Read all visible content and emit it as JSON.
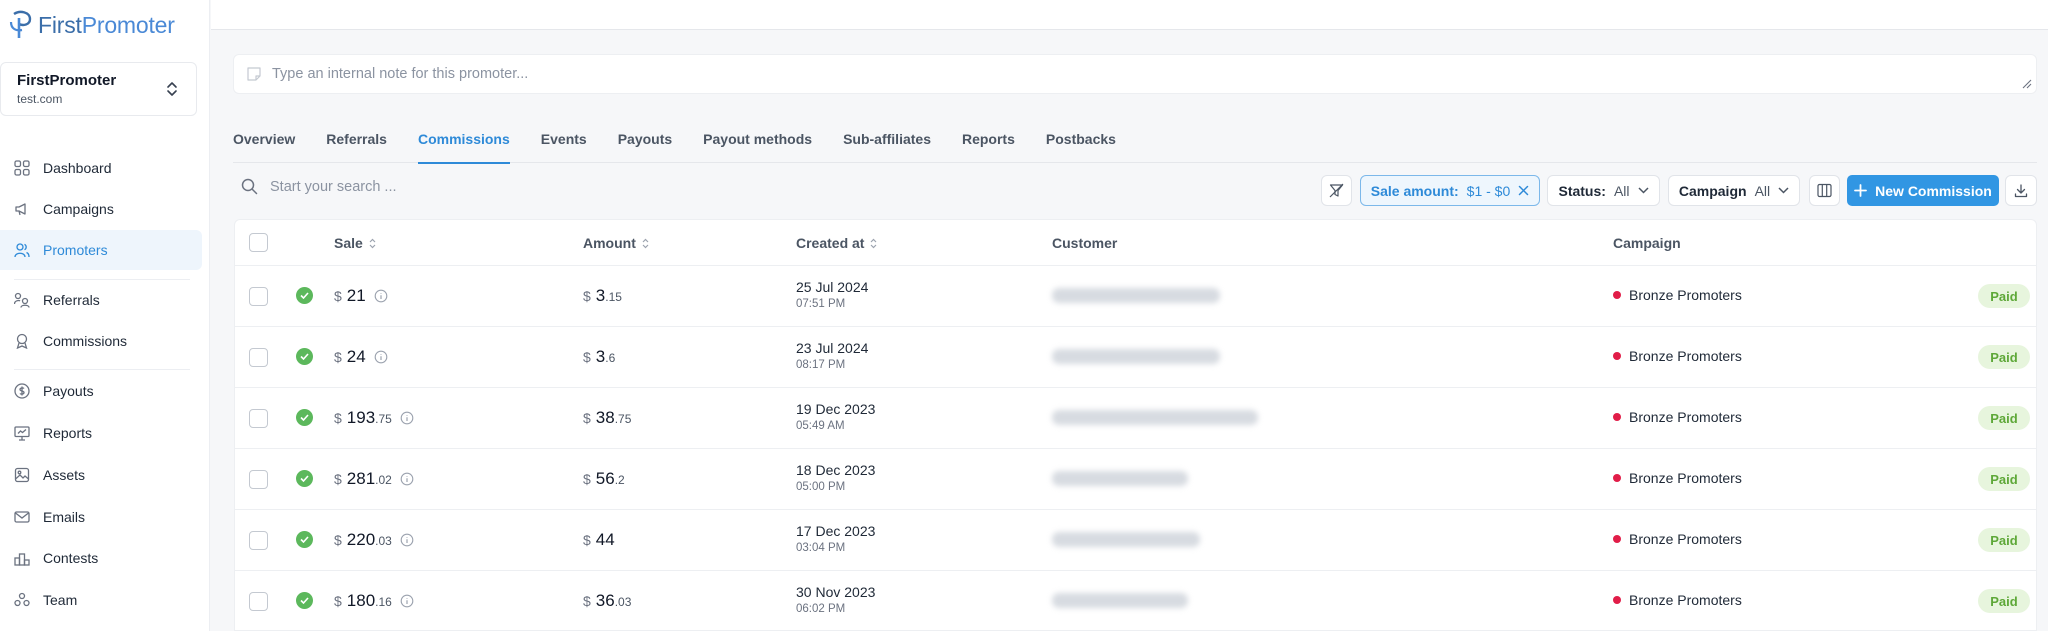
{
  "brand": {
    "name_first": "First",
    "name_second": "Promoter"
  },
  "account": {
    "name": "FirstPromoter",
    "domain": "test.com"
  },
  "sidebar": {
    "items": [
      {
        "label": "Dashboard",
        "icon": "dashboard-icon"
      },
      {
        "label": "Campaigns",
        "icon": "megaphone-icon"
      },
      {
        "label": "Promoters",
        "icon": "users-icon",
        "active": true
      },
      {
        "label": "Referrals",
        "icon": "referrals-icon"
      },
      {
        "label": "Commissions",
        "icon": "award-icon"
      },
      {
        "label": "Payouts",
        "icon": "dollar-circle-icon"
      },
      {
        "label": "Reports",
        "icon": "monitor-chart-icon"
      },
      {
        "label": "Assets",
        "icon": "image-icon"
      },
      {
        "label": "Emails",
        "icon": "mail-icon"
      },
      {
        "label": "Contests",
        "icon": "podium-icon"
      },
      {
        "label": "Team",
        "icon": "team-icon"
      }
    ]
  },
  "note": {
    "placeholder": "Type an internal note for this promoter..."
  },
  "tabs": [
    {
      "label": "Overview"
    },
    {
      "label": "Referrals"
    },
    {
      "label": "Commissions",
      "active": true
    },
    {
      "label": "Events"
    },
    {
      "label": "Payouts"
    },
    {
      "label": "Payout methods"
    },
    {
      "label": "Sub-affiliates"
    },
    {
      "label": "Reports"
    },
    {
      "label": "Postbacks"
    }
  ],
  "search": {
    "placeholder": "Start your search ..."
  },
  "filters": {
    "sale_label": "Sale amount:",
    "sale_value": "$1 - $0",
    "status_label": "Status:",
    "status_value": "All",
    "campaign_label": "Campaign",
    "campaign_value": "All"
  },
  "new_commission_label": "New Commission",
  "table": {
    "headers": {
      "sale": "Sale",
      "amount": "Amount",
      "created_at": "Created at",
      "customer": "Customer",
      "campaign": "Campaign"
    },
    "currency": "$",
    "rows": [
      {
        "sale_int": "21",
        "sale_dec": "",
        "amount_int": "3",
        "amount_dec": ".15",
        "date": "25 Jul 2024",
        "time": "07:51 PM",
        "campaign": "Bronze Promoters",
        "status": "Paid"
      },
      {
        "sale_int": "24",
        "sale_dec": "",
        "amount_int": "3",
        "amount_dec": ".6",
        "date": "23 Jul 2024",
        "time": "08:17 PM",
        "campaign": "Bronze Promoters",
        "status": "Paid"
      },
      {
        "sale_int": "193",
        "sale_dec": ".75",
        "amount_int": "38",
        "amount_dec": ".75",
        "date": "19 Dec 2023",
        "time": "05:49 AM",
        "campaign": "Bronze Promoters",
        "status": "Paid"
      },
      {
        "sale_int": "281",
        "sale_dec": ".02",
        "amount_int": "56",
        "amount_dec": ".2",
        "date": "18 Dec 2023",
        "time": "05:00 PM",
        "campaign": "Bronze Promoters",
        "status": "Paid"
      },
      {
        "sale_int": "220",
        "sale_dec": ".03",
        "amount_int": "44",
        "amount_dec": "",
        "date": "17 Dec 2023",
        "time": "03:04 PM",
        "campaign": "Bronze Promoters",
        "status": "Paid"
      },
      {
        "sale_int": "180",
        "sale_dec": ".16",
        "amount_int": "36",
        "amount_dec": ".03",
        "date": "30 Nov 2023",
        "time": "06:02 PM",
        "campaign": "Bronze Promoters",
        "status": "Paid"
      }
    ]
  },
  "colors": {
    "accent": "#2e8ad8",
    "paid_green": "#5cb85c",
    "campaign_dot": "#e11d48"
  }
}
